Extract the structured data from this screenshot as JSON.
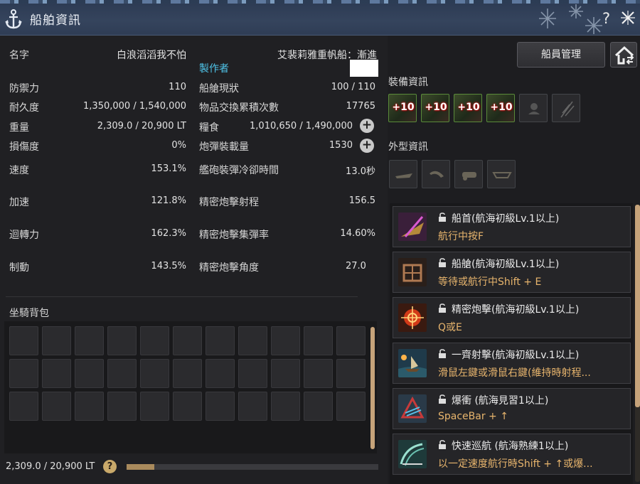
{
  "window": {
    "title": "船舶資訊",
    "help": "?",
    "colors": {
      "accent_blue": "#4fc3e8",
      "skill_key": "#e8b56d",
      "scroll": "#c6a37a"
    }
  },
  "ship": {
    "name_label": "名字",
    "name_value": "白浪滔滔我不怕",
    "type_value": "艾裴莉雅重帆船：漸進",
    "maker_label": "製作者"
  },
  "stats_left": [
    {
      "label": "防禦力",
      "value": "110"
    },
    {
      "label": "耐久度",
      "value": "1,350,000 / 1,540,000"
    },
    {
      "label": "重量",
      "value": "2,309.0 / 20,900 LT"
    },
    {
      "label": "損傷度",
      "value": "0%"
    },
    {
      "label": "速度",
      "value": "153.1%"
    },
    {
      "label": "加速",
      "value": "121.8%"
    },
    {
      "label": "迴轉力",
      "value": "162.3%"
    },
    {
      "label": "制動",
      "value": "143.5%"
    }
  ],
  "stats_right": [
    {
      "label": "船艙現狀",
      "value": "100 / 110"
    },
    {
      "label": "物品交換累積次數",
      "value": "17765"
    },
    {
      "label": "糧食",
      "value": "1,010,650 / 1,490,000"
    },
    {
      "label": "炮彈裝載量",
      "value": "1530"
    },
    {
      "label": "艦砲裝彈冷卻時間",
      "value": "13.0秒"
    },
    {
      "label": "精密炮擊射程",
      "value": "156.5"
    },
    {
      "label": "精密炮擊集彈率",
      "value": "14.60%"
    },
    {
      "label": "精密炮擊角度",
      "value": "27.0"
    }
  ],
  "plus_icon": "+",
  "inventory": {
    "title": "坐騎背包",
    "weight_text": "2,309.0 / 20,900 LT",
    "help": "?",
    "weight_ratio": 0.11
  },
  "buttons": {
    "crew": "船員管理"
  },
  "equipment": {
    "title": "裝備資訊",
    "slots": [
      {
        "enh": "+10",
        "icon": "ship-prow-equip-icon"
      },
      {
        "enh": "+10",
        "icon": "ship-plating-equip-icon"
      },
      {
        "enh": "+10",
        "icon": "ship-cannon-equip-icon"
      },
      {
        "enh": "+10",
        "icon": "ship-sail-equip-icon"
      },
      {
        "enh": "",
        "icon": "sailor-empty-icon"
      },
      {
        "enh": "",
        "icon": "flag-empty-icon"
      }
    ]
  },
  "appearance": {
    "title": "外型資訊"
  },
  "skills": [
    {
      "name": "船首(航海初級Lv.1以上)",
      "key": "航行中按F",
      "icon": "prow-skill-icon"
    },
    {
      "name": "船艙(航海初級Lv.1以上)",
      "key": "等待或航行中Shift + E",
      "icon": "cabin-skill-icon"
    },
    {
      "name": "精密炮擊(航海初級Lv.1以上)",
      "key": "Q或E",
      "icon": "precision-shot-icon"
    },
    {
      "name": "一齊射擊(航海初級Lv.1以上)",
      "key": "滑鼠左鍵或滑鼠右鍵(維持時射程...",
      "icon": "volley-fire-icon"
    },
    {
      "name": "爆衝 (航海見習1以上)",
      "key": "SpaceBar + ↑",
      "icon": "boost-skill-icon"
    },
    {
      "name": "快速巡航 (航海熟練1以上)",
      "key": "以一定速度航行時Shift + ↑或爆...",
      "icon": "cruise-skill-icon"
    }
  ]
}
